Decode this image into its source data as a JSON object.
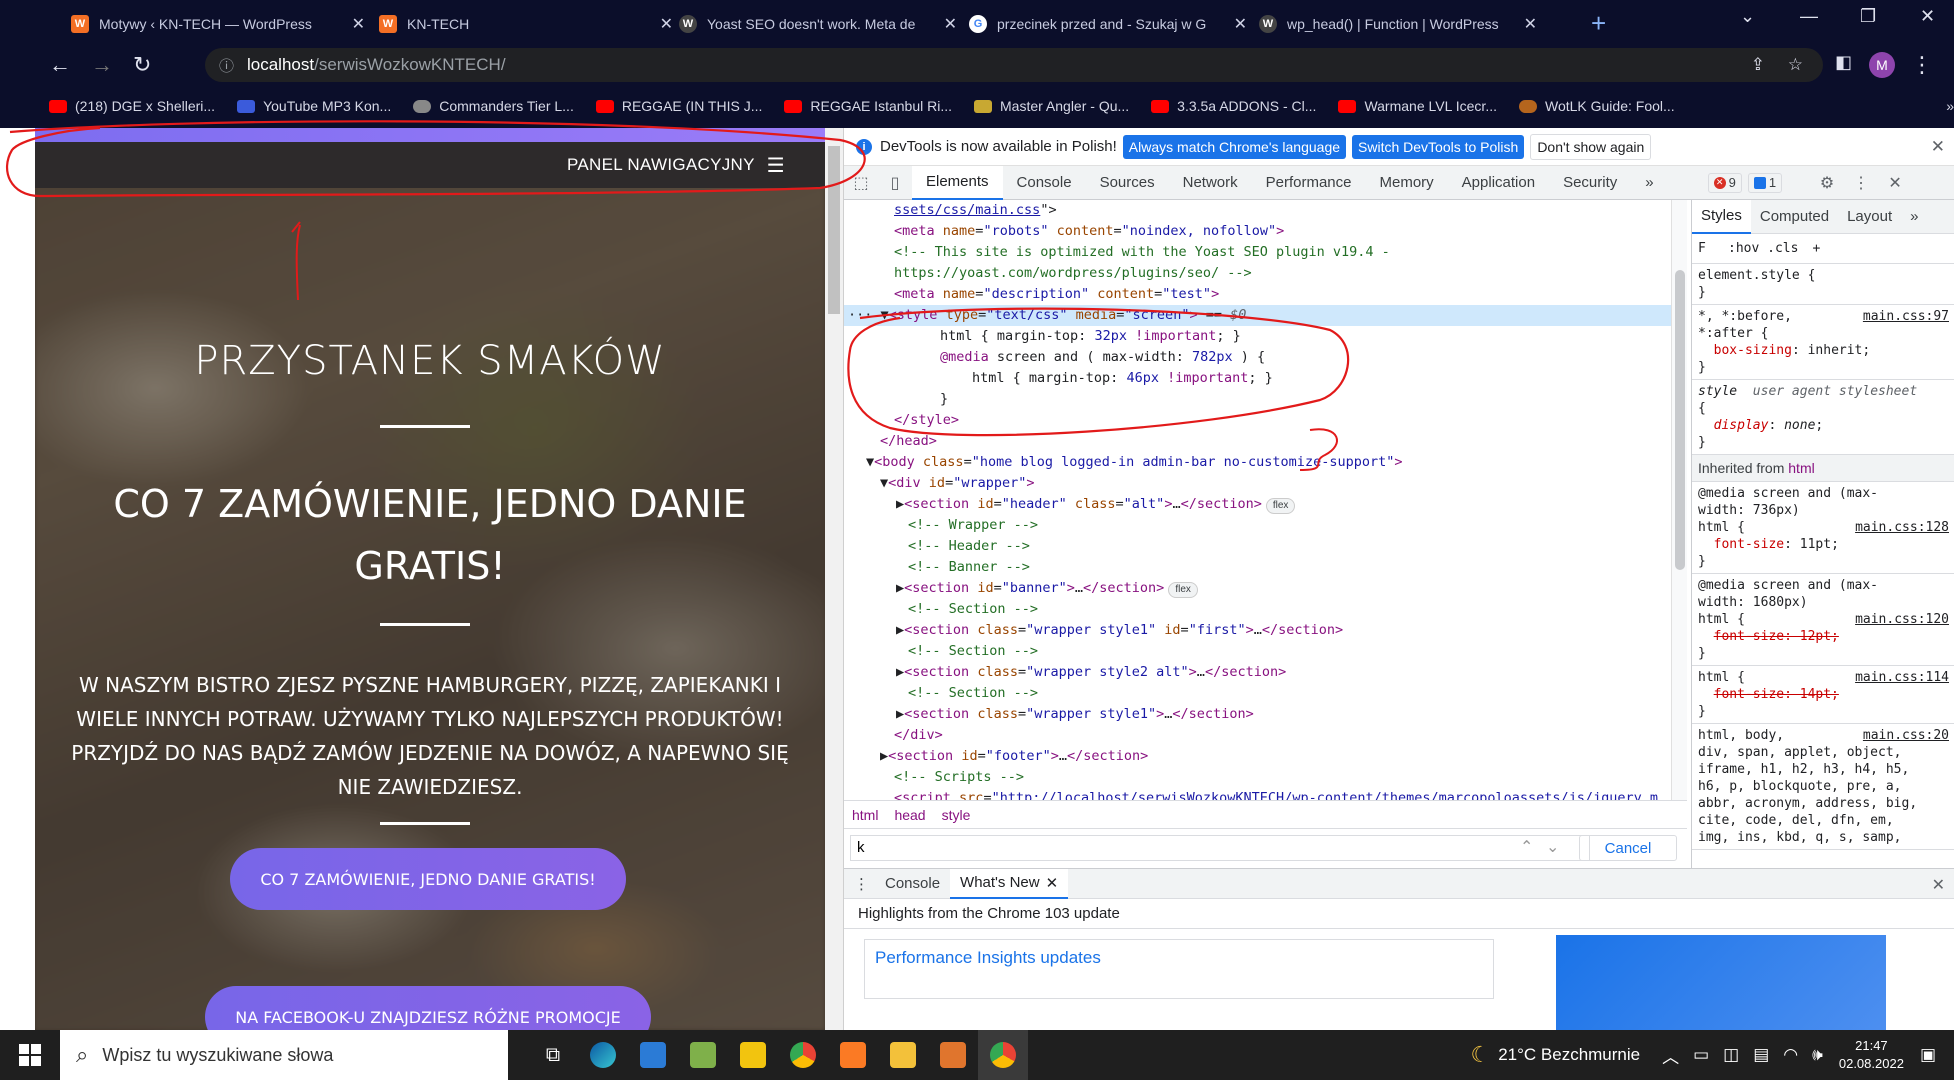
{
  "browser": {
    "tabs": [
      {
        "title": "Motywy ‹ KN-TECH — WordPress",
        "icon": "wordpress-orange-icon",
        "color": "#f46f25"
      },
      {
        "title": "KN-TECH",
        "icon": "wordpress-orange-icon",
        "color": "#f46f25"
      },
      {
        "title": "Yoast SEO doesn't work. Meta de",
        "icon": "wordpress-icon",
        "color": "#ffffff"
      },
      {
        "title": "przecinek przed and - Szukaj w G",
        "icon": "google-icon",
        "color": "#ffffff"
      },
      {
        "title": "wp_head() | Function | WordPress",
        "icon": "wordpress-icon",
        "color": "#ffffff"
      }
    ],
    "close_symbol": "✕",
    "new_tab_symbol": "+",
    "url_host": "localhost",
    "url_path": "/serwisWozkowKNTECH/",
    "profile_initial": "M",
    "bookmarks": [
      {
        "label": "(218) DGE x Shelleri...",
        "color": "#ff0000"
      },
      {
        "label": "YouTube MP3 Kon...",
        "color": "#3b5bdb"
      },
      {
        "label": "Commanders Tier L...",
        "color": "#888888"
      },
      {
        "label": "REGGAE (IN THIS J...",
        "color": "#ff0000"
      },
      {
        "label": "REGGAE Istanbul Ri...",
        "color": "#ff0000"
      },
      {
        "label": "Master Angler - Qu...",
        "color": "#c8a832"
      },
      {
        "label": "3.3.5a ADDONS - Cl...",
        "color": "#ff0000"
      },
      {
        "label": "Warmane LVL Icecr...",
        "color": "#ff0000"
      },
      {
        "label": "WotLK Guide: Fool...",
        "color": "#b5651d"
      }
    ]
  },
  "site": {
    "nav_label": "PANEL NAWIGACYJNY",
    "menu_symbol": "☰",
    "h1": "PRZYSTANEK SMAKÓW",
    "h2": "CO 7 ZAMÓWIENIE, JEDNO DANIE GRATIS!",
    "paragraph": "W NASZYM BISTRO ZJESZ PYSZNE HAMBURGERY, PIZZĘ, ZAPIEKANKI I WIELE INNYCH POTRAW. UŻYWAMY TYLKO NAJLEPSZYCH PRODUKTÓW! PRZYJDŹ DO NAS BĄDŹ ZAMÓW JEDZENIE NA DOWÓZ, A NAPEWNO SIĘ NIE ZAWIEDZIESZ.",
    "button1": "CO 7 ZAMÓWIENIE, JEDNO DANIE GRATIS!",
    "button2": "NA FACEBOOK-U ZNAJDZIESZ RÓŻNE PROMOCJE"
  },
  "devtools": {
    "infobar": {
      "message": "DevTools is now available in Polish!",
      "btn_match": "Always match Chrome's language",
      "btn_switch": "Switch DevTools to Polish",
      "btn_dismiss": "Don't show again"
    },
    "tabs": [
      "Elements",
      "Console",
      "Sources",
      "Network",
      "Performance",
      "Memory",
      "Application",
      "Security"
    ],
    "more_symbol": "»",
    "error_count": "9",
    "message_count": "1",
    "breadcrumbs": [
      "html",
      "head",
      "style"
    ],
    "search_value": "k",
    "search_cancel": "Cancel",
    "styles_tabs": [
      "Styles",
      "Computed",
      "Layout"
    ],
    "styles_filter": ":hov  .cls",
    "inherited_from": "Inherited from",
    "inherited_tag": "html",
    "drawer_tabs": [
      "Console",
      "What's New"
    ],
    "drawer_heading": "Highlights from the Chrome 103 update",
    "drawer_card": "Performance Insights updates"
  },
  "taskbar": {
    "search_placeholder": "Wpisz tu wyszukiwane słowa",
    "weather": "21°C  Bezchmurnie",
    "time": "21:47",
    "date": "02.08.2022"
  }
}
